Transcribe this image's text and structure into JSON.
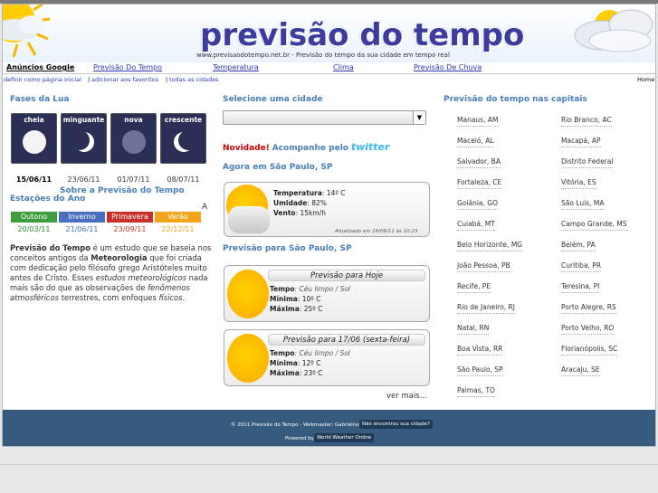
{
  "header": {
    "logo": "previsão do tempo",
    "tagline": "www.previsaodotempo.net.br - Previsão do tempo da sua cidade em tempo real"
  },
  "nav": {
    "items": [
      "Anúncios Google",
      "Previsão Do Tempo",
      "Temperatura",
      "Clima",
      "Previsão De Chuva"
    ]
  },
  "subnav": {
    "links": [
      "definir como página inicial",
      "adicionar aos favoritos",
      "todas as cidades"
    ],
    "separator": "|",
    "home": "Home"
  },
  "moon": {
    "title": "Fases da Lua",
    "phases": [
      {
        "label": "cheia",
        "date": "15/06/11"
      },
      {
        "label": "minguante",
        "date": "23/06/11"
      },
      {
        "label": "nova",
        "date": "01/07/11"
      },
      {
        "label": "crescente",
        "date": "08/07/11"
      }
    ],
    "about_link": "Sobre a Previsão do Tempo"
  },
  "seasons": {
    "title": "Estações do Ano",
    "stray": "A",
    "items": [
      {
        "label": "Outono",
        "date": "20/03/11",
        "color": "#3e9e3e",
        "date_color": "#2e8b2e"
      },
      {
        "label": "Inverno",
        "date": "21/06/11",
        "color": "#4a6fbf",
        "date_color": "#4a6fbf"
      },
      {
        "label": "Primavera",
        "date": "23/09/11",
        "color": "#c8312b",
        "date_color": "#c8312b"
      },
      {
        "label": "Verão",
        "date": "22/12/11",
        "color": "#f2a41b",
        "date_color": "#e8a317"
      }
    ]
  },
  "intro": {
    "t1": "Previsão do Tempo",
    "t2": " é um estudo que se baseia nos conceitos antigos da ",
    "t3": "Meteorologia",
    "t4": " que foi criada com dedicação pelo filósofo grego Aristóteles muito antes de Cristo. Esses ",
    "t5": "estudos meteorológicos",
    "t6": " nada mais são do que as observações de ",
    "t7": "fenômenos atmosféricos",
    "t8": " terrestres, com enfoques ",
    "t9": "físicos",
    "t10": "."
  },
  "city_select": {
    "title": "Selecione uma cidade",
    "value": ""
  },
  "novidade": {
    "label": "Novidade!",
    "text": "Acompanhe pelo",
    "brand": "twitter"
  },
  "now": {
    "title": "Agora em São Paulo, SP",
    "temp_label": "Temperatura",
    "temp": ": 14º C",
    "hum_label": "Umidade",
    "hum": ": 82%",
    "wind_label": "Vento",
    "wind": ": 15km/h",
    "updated": "Atualizado em 16/06/11 às 10:23"
  },
  "forecast": {
    "title": "Previsão para São Paulo, SP",
    "days": [
      {
        "title": "Previsão para Hoje",
        "tempo_label": "Tempo",
        "tempo": ": Céu limpo / Sol",
        "min_label": "Mínima",
        "min": ": 10º C",
        "max_label": "Máxima",
        "max": ": 25º C"
      },
      {
        "title": "Previsão para 17/06 (sexta-feira)",
        "tempo_label": "Tempo",
        "tempo": ": Céu limpo / Sol",
        "min_label": "Mínima",
        "min": ": 12º C",
        "max_label": "Máxima",
        "max": ": 23º C"
      }
    ],
    "more": "ver mais..."
  },
  "capitals": {
    "title": "Previsão do tempo nas capitais",
    "left": [
      "Manaus, AM",
      "Maceió, AL",
      "Salvador, BA",
      "Fortaleza, CE",
      "Goiânia, GO",
      "Cuiabá, MT",
      "Belo Horizonte, MG",
      "João Pessoa, PB",
      "Recife, PE",
      "Rio de Janeiro, RJ",
      "Natal, RN",
      "Boa Vista, RR",
      "São Paulo, SP",
      "Palmas, TO"
    ],
    "right": [
      "Rio Branco, AC",
      "Macapá, AP",
      "Distrito Federal",
      "Vitória, ES",
      "São Luis, MA",
      "Campo Grande, MS",
      "Belém, PA",
      "Curitiba, PR",
      "Teresina, PI",
      "Porto Alegre, RS",
      "Porto Velho, RO",
      "Florianópolis, SC",
      "Aracaju, SE"
    ]
  },
  "footer": {
    "line1": "© 2011 Previsão do Tempo - Webmaster: Gabrielrsd -",
    "not_found": "Não encontrou sua cidade?",
    "powered": "Powered by",
    "wwo": "World Weather Online"
  }
}
